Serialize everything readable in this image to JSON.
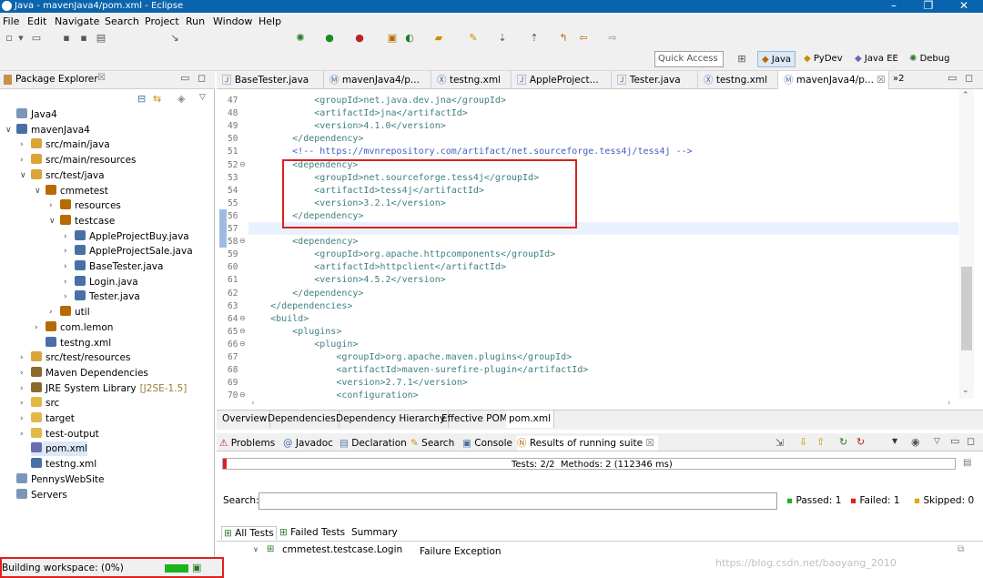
{
  "title": "Java - mavenJava4/pom.xml - Eclipse",
  "window_controls": [
    "–",
    "❐",
    "✕"
  ],
  "menu": [
    "File",
    "Edit",
    "Navigate",
    "Search",
    "Project",
    "Run",
    "Window",
    "Help"
  ],
  "quick_access": "Quick Access",
  "perspectives": [
    "Java",
    "PyDev",
    "Java EE",
    "Debug"
  ],
  "package_explorer": {
    "title": "Package Explorer",
    "items": [
      {
        "label": "Java4",
        "icon": "project-icon",
        "depth": 0
      },
      {
        "label": "mavenJava4",
        "icon": "maven-project-icon",
        "depth": 0,
        "expanded": true
      },
      {
        "label": "src/main/java",
        "icon": "source-folder-icon",
        "depth": 1
      },
      {
        "label": "src/main/resources",
        "icon": "source-folder-icon",
        "depth": 1
      },
      {
        "label": "src/test/java",
        "icon": "source-folder-icon",
        "depth": 1,
        "expanded": true
      },
      {
        "label": "cmmetest",
        "icon": "package-icon",
        "depth": 2,
        "expanded": true
      },
      {
        "label": "resources",
        "icon": "package-icon",
        "depth": 3
      },
      {
        "label": "testcase",
        "icon": "package-icon",
        "depth": 3,
        "expanded": true
      },
      {
        "label": "AppleProjectBuy.java",
        "icon": "java-file-icon",
        "depth": 4
      },
      {
        "label": "AppleProjectSale.java",
        "icon": "java-file-icon",
        "depth": 4
      },
      {
        "label": "BaseTester.java",
        "icon": "java-file-icon",
        "depth": 4
      },
      {
        "label": "Login.java",
        "icon": "java-file-icon",
        "depth": 4
      },
      {
        "label": "Tester.java",
        "icon": "java-file-icon",
        "depth": 4
      },
      {
        "label": "util",
        "icon": "package-icon",
        "depth": 3
      },
      {
        "label": "com.lemon",
        "icon": "package-icon",
        "depth": 2
      },
      {
        "label": "testng.xml",
        "icon": "xml-file-icon",
        "depth": 2
      },
      {
        "label": "src/test/resources",
        "icon": "source-folder-icon",
        "depth": 1
      },
      {
        "label": "Maven Dependencies",
        "icon": "library-icon",
        "depth": 1
      },
      {
        "label": "JRE System Library",
        "suffix": "[J2SE-1.5]",
        "icon": "library-icon",
        "depth": 1
      },
      {
        "label": "src",
        "icon": "folder-icon",
        "depth": 1
      },
      {
        "label": "target",
        "icon": "folder-icon",
        "depth": 1
      },
      {
        "label": "test-output",
        "icon": "folder-icon",
        "depth": 1
      },
      {
        "label": "pom.xml",
        "icon": "maven-file-icon",
        "depth": 1,
        "selected": true
      },
      {
        "label": "testng.xml",
        "icon": "xml-file-icon",
        "depth": 1
      },
      {
        "label": "PennysWebSite",
        "icon": "project-icon",
        "depth": 0
      },
      {
        "label": "Servers",
        "icon": "project-icon",
        "depth": 0
      }
    ]
  },
  "status_bar": {
    "text": "Building workspace: (0%)"
  },
  "editor_tabs": [
    "BaseTester.java",
    "mavenJava4/p...",
    "testng.xml",
    "AppleProject...",
    "Tester.java",
    "testng.xml",
    "mavenJava4/p..."
  ],
  "editor_tabs_overflow": "»2",
  "code_lines": [
    {
      "n": "47",
      "text": "            <groupId>net.java.dev.jna</groupId>"
    },
    {
      "n": "48",
      "text": "            <artifactId>jna</artifactId>"
    },
    {
      "n": "49",
      "text": "            <version>4.1.0</version>"
    },
    {
      "n": "50",
      "text": "        </dependency>"
    },
    {
      "n": "51",
      "text": "        <!-- https://mvnrepository.com/artifact/net.sourceforge.tess4j/tess4j -->"
    },
    {
      "n": "52",
      "text": "        <dependency>"
    },
    {
      "n": "53",
      "text": "            <groupId>net.sourceforge.tess4j</groupId>"
    },
    {
      "n": "54",
      "text": "            <artifactId>tess4j</artifactId>"
    },
    {
      "n": "55",
      "text": "            <version>3.2.1</version>"
    },
    {
      "n": "56",
      "text": "        </dependency>"
    },
    {
      "n": "57",
      "text": ""
    },
    {
      "n": "58",
      "text": "        <dependency>"
    },
    {
      "n": "59",
      "text": "            <groupId>org.apache.httpcomponents</groupId>"
    },
    {
      "n": "60",
      "text": "            <artifactId>httpclient</artifactId>"
    },
    {
      "n": "61",
      "text": "            <version>4.5.2</version>"
    },
    {
      "n": "62",
      "text": "        </dependency>"
    },
    {
      "n": "63",
      "text": "    </dependencies>"
    },
    {
      "n": "64",
      "text": "    <build>"
    },
    {
      "n": "65",
      "text": "        <plugins>"
    },
    {
      "n": "66",
      "text": "            <plugin>"
    },
    {
      "n": "67",
      "text": "                <groupId>org.apache.maven.plugins</groupId>"
    },
    {
      "n": "68",
      "text": "                <artifactId>maven-surefire-plugin</artifactId>"
    },
    {
      "n": "69",
      "text": "                <version>2.7.1</version>"
    },
    {
      "n": "70",
      "text": "                <configuration>"
    }
  ],
  "pom_tabs": [
    "Overview",
    "Dependencies",
    "Dependency Hierarchy",
    "Effective POM",
    "pom.xml"
  ],
  "bottom_tabs": [
    "Problems",
    "Javadoc",
    "Declaration",
    "Search",
    "Console",
    "Results of running suite"
  ],
  "results": {
    "summary": "Tests: 2/2  Methods: 2 (112346 ms)",
    "search_label": "Search:",
    "passed": "Passed: 1",
    "failed": "Failed: 1",
    "skipped": "Skipped: 0",
    "sub_tabs": [
      "All Tests",
      "Failed Tests",
      "Summary"
    ],
    "tree_item": "cmmetest.testcase.Login",
    "failure_label": "Failure Exception",
    "progress": 0.005
  },
  "watermark": "https://blog.csdn.net/baoyang_2010",
  "colors": {
    "highlight_box": "#e0201e",
    "progress": "#1db31d",
    "title_bar": "#0a64ad",
    "xml_tag": "#3f7f7f",
    "comment": "#3f5fbf"
  }
}
